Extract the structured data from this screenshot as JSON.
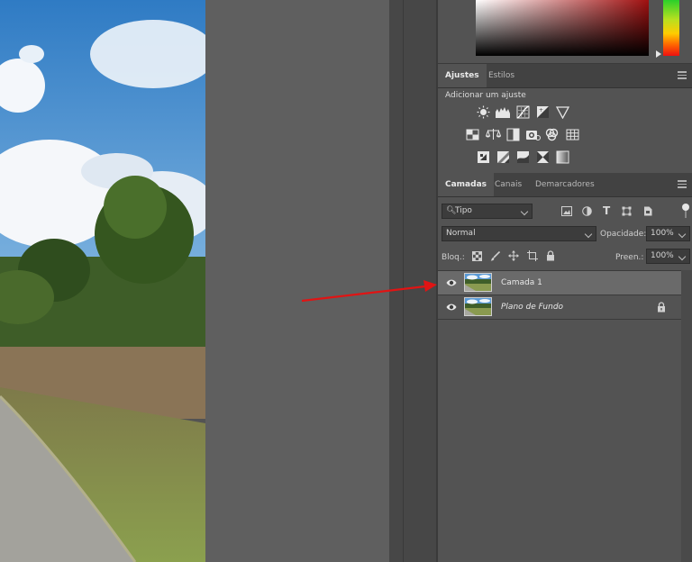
{
  "adjustments_panel": {
    "tabs": [
      {
        "label": "Ajustes",
        "active": true
      },
      {
        "label": "Estilos",
        "active": false
      }
    ],
    "add_adjustment_label": "Adicionar um ajuste",
    "icons_row1": [
      "brightness-contrast-icon",
      "levels-icon",
      "curves-icon",
      "exposure-icon",
      "vibrance-icon"
    ],
    "icons_row2": [
      "hue-saturation-icon",
      "color-balance-icon",
      "black-white-icon",
      "photo-filter-icon",
      "channel-mixer-icon",
      "color-lookup-icon"
    ],
    "icons_row3": [
      "invert-icon",
      "posterize-icon",
      "threshold-icon",
      "selective-color-icon",
      "gradient-map-icon"
    ]
  },
  "layers_panel": {
    "tabs": [
      {
        "label": "Camadas",
        "active": true
      },
      {
        "label": "Canais",
        "active": false
      },
      {
        "label": "Demarcadores",
        "active": false
      }
    ],
    "filter_type": "Tipo",
    "blend_mode": "Normal",
    "opacity_label": "Opacidade:",
    "opacity_value": "100%",
    "lock_label": "Bloq.:",
    "fill_label": "Preen.:",
    "fill_value": "100%",
    "layers": [
      {
        "name": "Camada 1",
        "visible": true,
        "selected": true,
        "locked": false
      },
      {
        "name": "Plano de Fundo",
        "visible": true,
        "selected": false,
        "locked": true
      }
    ]
  },
  "colors": {
    "panel_bg": "#535353",
    "accent_arrow": "#e01414"
  }
}
